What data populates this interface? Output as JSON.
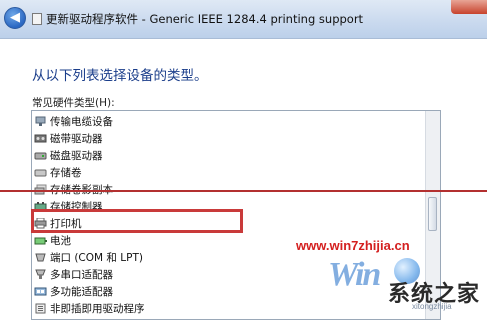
{
  "window": {
    "title": "更新驱动程序软件 - Generic IEEE 1284.4 printing support",
    "back_glyph": "◀"
  },
  "main": {
    "heading": "从以下列表选择设备的类型。",
    "list_label": "常见硬件类型(H):"
  },
  "hardware_list": {
    "items": [
      {
        "label": "传输电缆设备",
        "icon": "cable-device-icon"
      },
      {
        "label": "磁带驱动器",
        "icon": "tape-drive-icon"
      },
      {
        "label": "磁盘驱动器",
        "icon": "disk-drive-icon"
      },
      {
        "label": "存储卷",
        "icon": "storage-volume-icon"
      },
      {
        "label": "存储卷影副本",
        "icon": "volume-shadow-copy-icon"
      },
      {
        "label": "存储控制器",
        "icon": "storage-controller-icon"
      },
      {
        "label": "打印机",
        "icon": "printer-icon"
      },
      {
        "label": "电池",
        "icon": "battery-icon"
      },
      {
        "label": "端口 (COM 和 LPT)",
        "icon": "port-icon"
      },
      {
        "label": "多串口适配器",
        "icon": "multiport-serial-icon"
      },
      {
        "label": "多功能适配器",
        "icon": "multifunction-adapter-icon"
      },
      {
        "label": "非即插即用驱动程序",
        "icon": "non-pnp-driver-icon"
      }
    ],
    "highlighted": "打印机"
  },
  "watermark": {
    "url": "www.win7zhijia.cn",
    "logo": "Win",
    "brand": "系统之家",
    "sub": "xitongzhijia"
  },
  "colors": {
    "heading": "#1a3d8a",
    "annotation_red": "#c93a3a",
    "watermark_red": "#d42020"
  }
}
